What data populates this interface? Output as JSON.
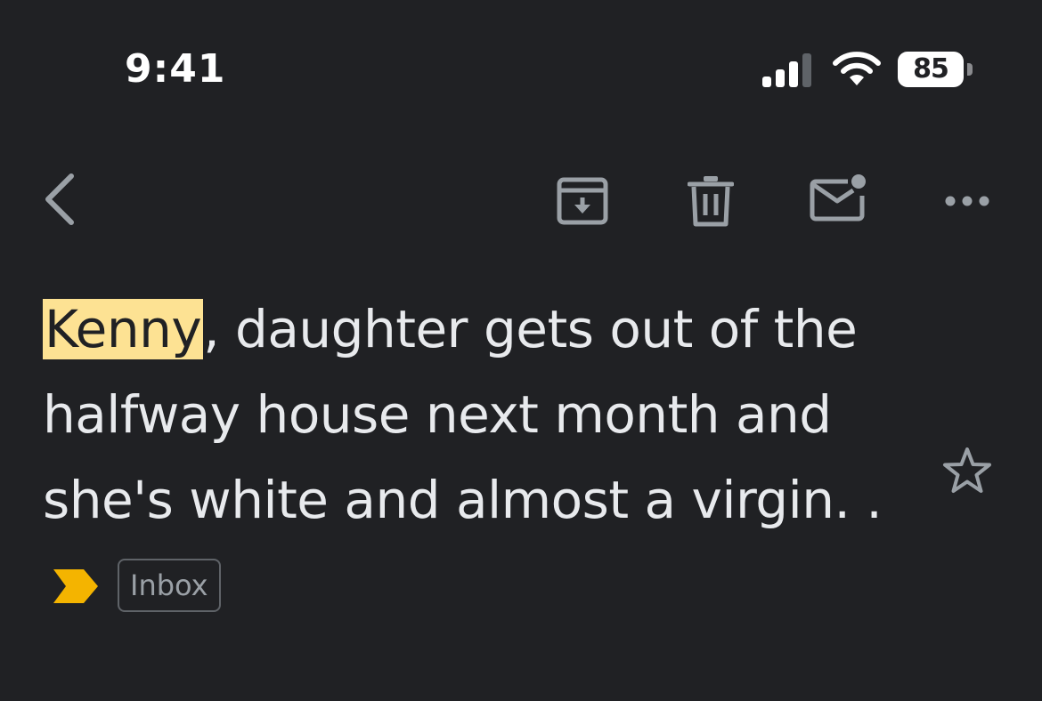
{
  "status_bar": {
    "time": "9:41",
    "battery_level": "85"
  },
  "toolbar": {
    "back": "back",
    "archive": "archive",
    "delete": "delete",
    "mark_unread": "mark unread",
    "more": "more options"
  },
  "email": {
    "highlighted_name": "Kenny",
    "subject_rest": ", daughter gets out of the halfway house next month and she's white and almost a virgin. .",
    "starred": false,
    "important": true,
    "label": "Inbox"
  },
  "colors": {
    "background": "#202124",
    "text": "#e8eaed",
    "icon": "#9aa0a6",
    "highlight": "#fde293",
    "important_marker": "#f4b400"
  }
}
